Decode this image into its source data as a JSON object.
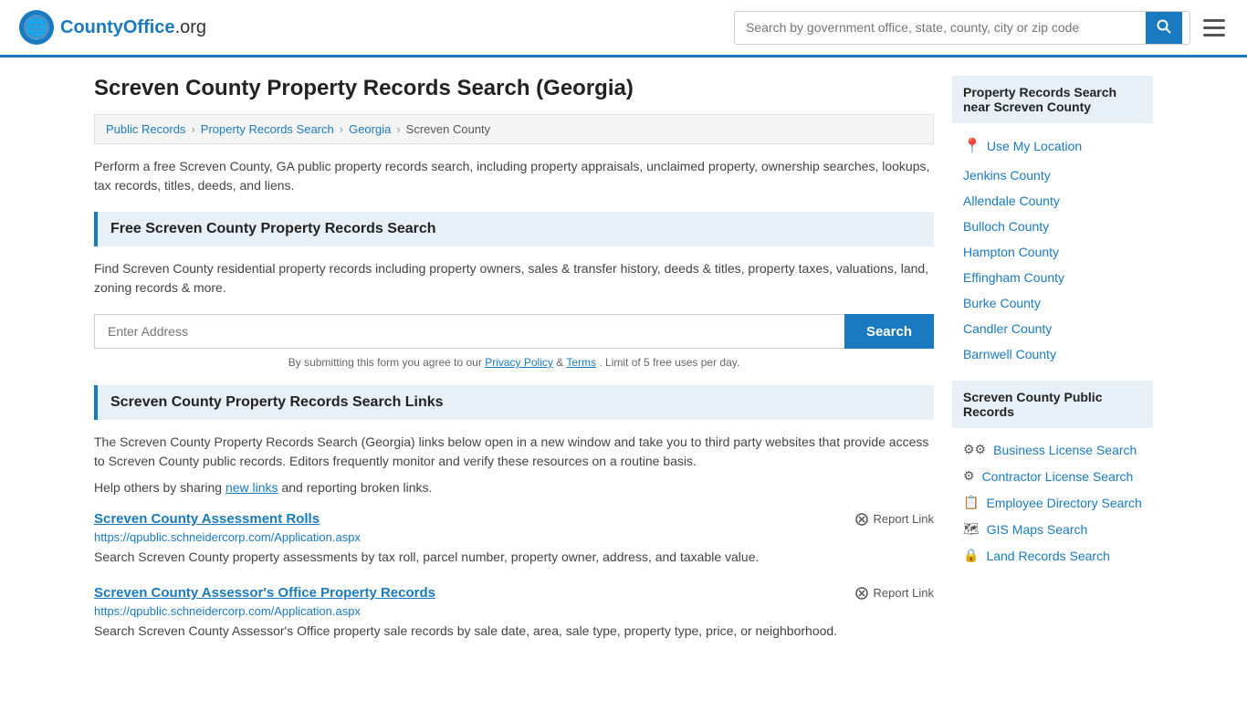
{
  "header": {
    "logo_text": "CountyOffice",
    "logo_suffix": ".org",
    "search_placeholder": "Search by government office, state, county, city or zip code",
    "search_icon": "🔍"
  },
  "page": {
    "title": "Screven County Property Records Search (Georgia)",
    "breadcrumb": [
      {
        "label": "Public Records",
        "href": "#"
      },
      {
        "label": "Property Records Search",
        "href": "#"
      },
      {
        "label": "Georgia",
        "href": "#"
      },
      {
        "label": "Screven County",
        "href": "#"
      }
    ],
    "description": "Perform a free Screven County, GA public property records search, including property appraisals, unclaimed property, ownership searches, lookups, tax records, titles, deeds, and liens.",
    "free_search_section": {
      "title": "Free Screven County Property Records Search",
      "description": "Find Screven County residential property records including property owners, sales & transfer history, deeds & titles, property taxes, valuations, land, zoning records & more.",
      "address_placeholder": "Enter Address",
      "search_button": "Search",
      "disclaimer": "By submitting this form you agree to our",
      "privacy_label": "Privacy Policy",
      "terms_label": "Terms",
      "limit_text": ". Limit of 5 free uses per day."
    },
    "links_section": {
      "title": "Screven County Property Records Search Links",
      "description": "The Screven County Property Records Search (Georgia) links below open in a new window and take you to third party websites that provide access to Screven County public records. Editors frequently monitor and verify these resources on a routine basis.",
      "share_text": "Help others by sharing",
      "new_links_label": "new links",
      "share_text2": "and reporting broken links.",
      "records": [
        {
          "title": "Screven County Assessment Rolls",
          "url": "https://qpublic.schneidercorp.com/Application.aspx",
          "description": "Search Screven County property assessments by tax roll, parcel number, property owner, address, and taxable value.",
          "report_label": "Report Link"
        },
        {
          "title": "Screven County Assessor's Office Property Records",
          "url": "https://qpublic.schneidercorp.com/Application.aspx",
          "description": "Search Screven County Assessor's Office property sale records by sale date, area, sale type, property type, price, or neighborhood.",
          "report_label": "Report Link"
        }
      ]
    }
  },
  "sidebar": {
    "nearby_title": "Property Records Search near Screven County",
    "use_location_label": "Use My Location",
    "nearby_counties": [
      "Jenkins County",
      "Allendale County",
      "Bulloch County",
      "Hampton County",
      "Effingham County",
      "Burke County",
      "Candler County",
      "Barnwell County"
    ],
    "public_records_title": "Screven County Public Records",
    "public_records_items": [
      {
        "icon": "⚙",
        "label": "Business License Search"
      },
      {
        "icon": "⚙",
        "label": "Contractor License Search"
      },
      {
        "icon": "📋",
        "label": "Employee Directory Search"
      },
      {
        "icon": "🗺",
        "label": "GIS Maps Search"
      },
      {
        "icon": "🔒",
        "label": "Land Records Search"
      }
    ]
  }
}
